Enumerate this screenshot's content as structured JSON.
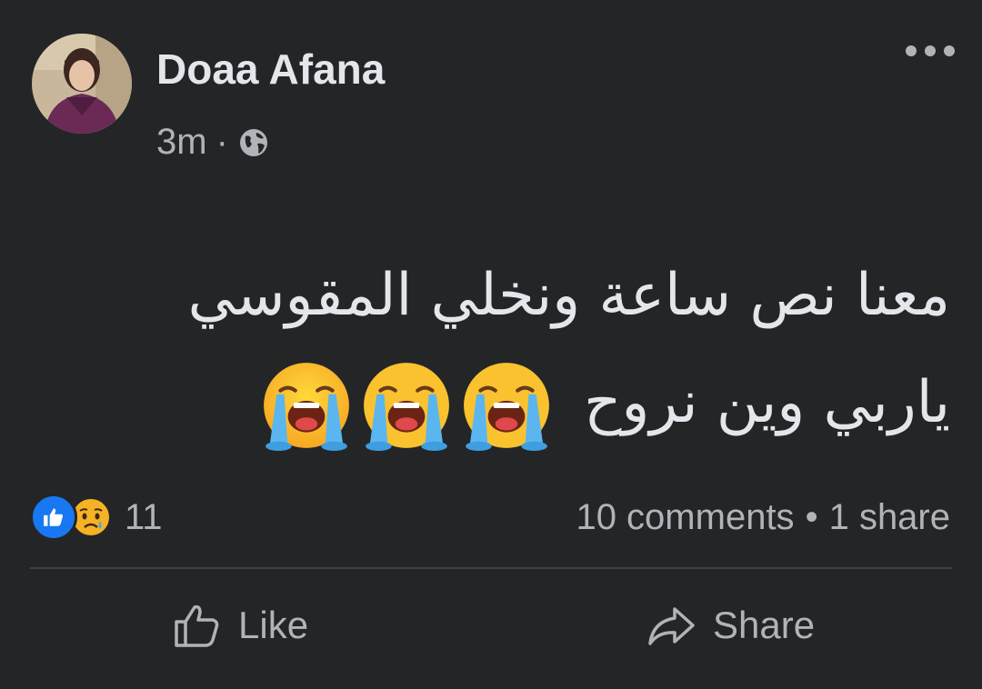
{
  "post": {
    "author": "Doaa Afana",
    "time": "3m",
    "separator": "·",
    "audience_icon": "globe-icon",
    "text_line1": "معنا نص ساعة ونخلي المقوسي",
    "text_line2": "ياربي وين نروح"
  },
  "reactions": {
    "icons": [
      "like-icon",
      "sad-icon"
    ],
    "count": "11"
  },
  "stats": {
    "comments": "10 comments",
    "separator": "•",
    "shares": "1 share"
  },
  "actions": {
    "like_label": "Like",
    "share_label": "Share"
  },
  "colors": {
    "background": "#242526",
    "primary_text": "#e4e6eb",
    "secondary_text": "#b0b3b8",
    "like_blue": "#1877f2",
    "divider": "#3e4042"
  }
}
